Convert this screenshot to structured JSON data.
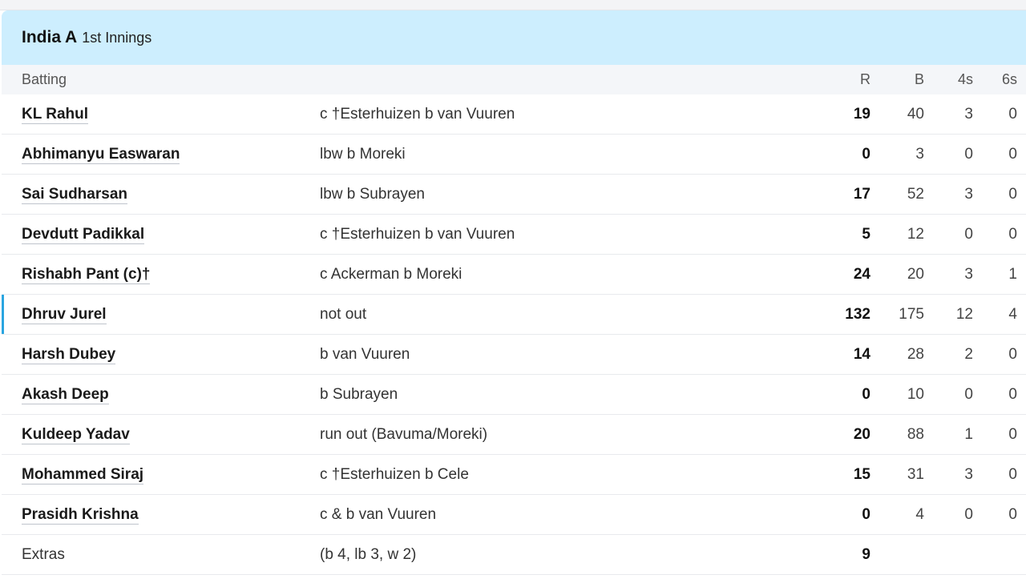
{
  "innings": {
    "team": "India A",
    "label": "1st Innings"
  },
  "columns": {
    "batting": "Batting",
    "runs": "R",
    "balls": "B",
    "fours": "4s",
    "sixes": "6s"
  },
  "batters": [
    {
      "name": "KL Rahul",
      "dismissal": "c †Esterhuizen b van Vuuren",
      "r": "19",
      "b": "40",
      "fours": "3",
      "sixes": "0"
    },
    {
      "name": "Abhimanyu Easwaran",
      "dismissal": "lbw b Moreki",
      "r": "0",
      "b": "3",
      "fours": "0",
      "sixes": "0"
    },
    {
      "name": "Sai Sudharsan",
      "dismissal": "lbw b Subrayen",
      "r": "17",
      "b": "52",
      "fours": "3",
      "sixes": "0"
    },
    {
      "name": "Devdutt Padikkal",
      "dismissal": "c †Esterhuizen b van Vuuren",
      "r": "5",
      "b": "12",
      "fours": "0",
      "sixes": "0"
    },
    {
      "name": "Rishabh Pant (c)†",
      "dismissal": "c Ackerman b Moreki",
      "r": "24",
      "b": "20",
      "fours": "3",
      "sixes": "1"
    },
    {
      "name": "Dhruv Jurel",
      "dismissal": "not out",
      "r": "132",
      "b": "175",
      "fours": "12",
      "sixes": "4"
    },
    {
      "name": "Harsh Dubey",
      "dismissal": "b van Vuuren",
      "r": "14",
      "b": "28",
      "fours": "2",
      "sixes": "0"
    },
    {
      "name": "Akash Deep",
      "dismissal": "b Subrayen",
      "r": "0",
      "b": "10",
      "fours": "0",
      "sixes": "0"
    },
    {
      "name": "Kuldeep Yadav",
      "dismissal": "run out (Bavuma/Moreki)",
      "r": "20",
      "b": "88",
      "fours": "1",
      "sixes": "0"
    },
    {
      "name": "Mohammed Siraj",
      "dismissal": "c †Esterhuizen b Cele",
      "r": "15",
      "b": "31",
      "fours": "3",
      "sixes": "0"
    },
    {
      "name": "Prasidh Krishna",
      "dismissal": "c & b van Vuuren",
      "r": "0",
      "b": "4",
      "fours": "0",
      "sixes": "0"
    }
  ],
  "extras": {
    "label": "Extras",
    "detail": "(b 4, lb 3, w 2)",
    "total": "9"
  },
  "colors": {
    "header_bg": "#cdeefe",
    "highlight_bar": "#2aa5e0"
  }
}
